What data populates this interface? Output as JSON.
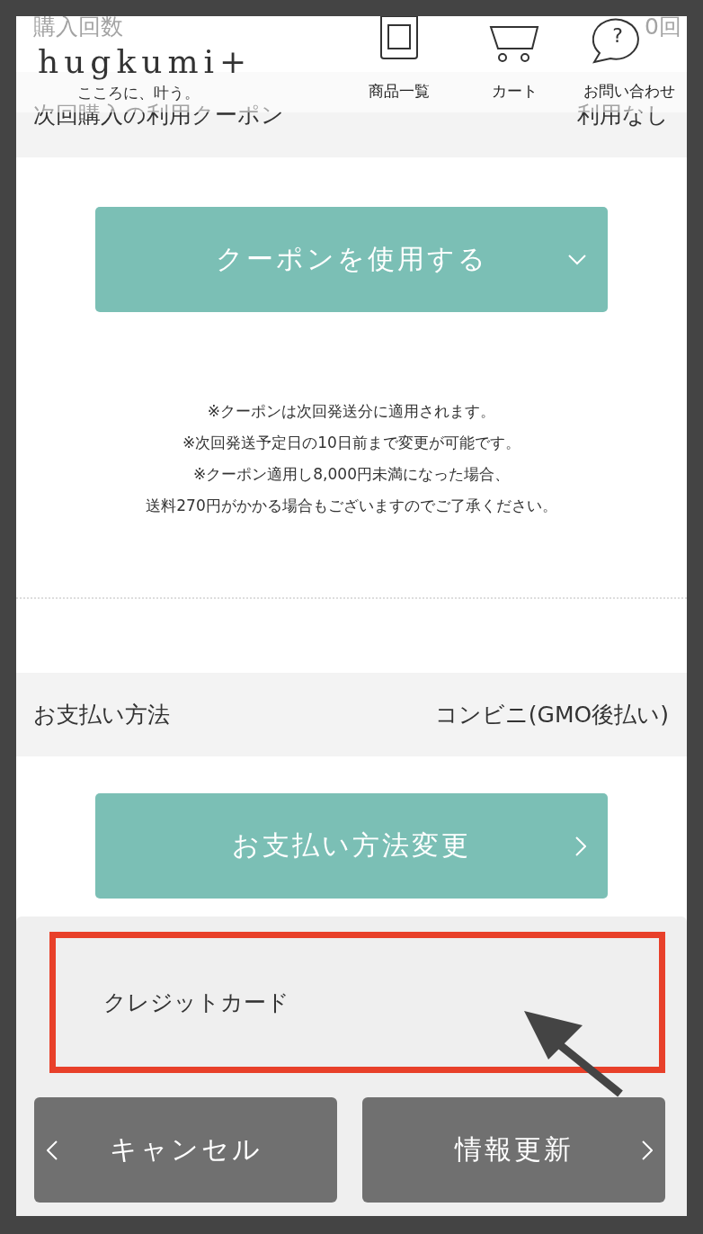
{
  "header": {
    "logo": "hugkumi+",
    "tagline": "こころに、叶う。",
    "nav": [
      {
        "kind": "products",
        "label": "商品一覧"
      },
      {
        "kind": "cart",
        "label": "カート"
      },
      {
        "kind": "help",
        "label": "お問い合わせ",
        "glyph": "?"
      }
    ]
  },
  "purchase_count": {
    "label": "購入回数",
    "value": "0回"
  },
  "coupon": {
    "label": "次回購入の利用クーポン",
    "value": "利用なし",
    "button": "クーポンを使用する",
    "expanded": false,
    "notes": [
      "※クーポンは次回発送分に適用されます。",
      "※次回発送予定日の10日前まで変更が可能です。",
      "※クーポン適用し8,000円未満になった場合、",
      "送料270円がかかる場合もございますのでご了承ください。"
    ]
  },
  "payment": {
    "label": "お支払い方法",
    "value": "コンビニ(GMO後払い)",
    "button": "お支払い方法変更",
    "options": [
      {
        "label": "クレジットカード",
        "highlighted": true
      }
    ]
  },
  "actions": [
    {
      "kind": "back",
      "label": "キャンセル"
    },
    {
      "kind": "forward",
      "label": "情報更新"
    }
  ]
}
